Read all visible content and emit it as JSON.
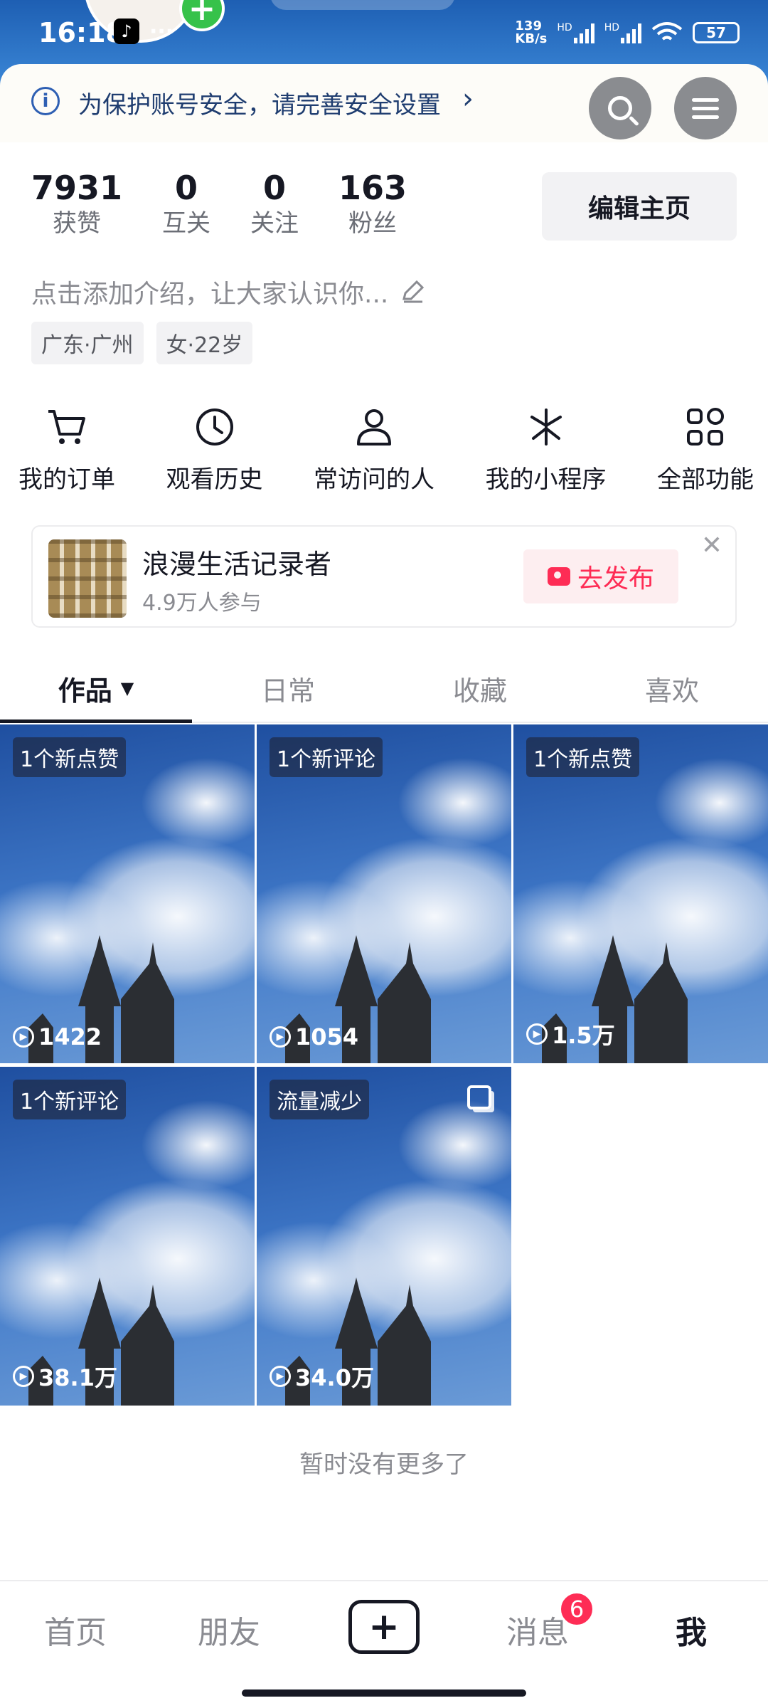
{
  "status_bar": {
    "time": "16:18",
    "net_speed_value": "139",
    "net_speed_unit": "KB/s",
    "hd1": "HD",
    "hd2": "HD",
    "battery": "57"
  },
  "security_banner": {
    "text": "为保护账号安全，请完善安全设置",
    "icon": "info-icon"
  },
  "stats": [
    {
      "value": "7931",
      "label": "获赞"
    },
    {
      "value": "0",
      "label": "互关"
    },
    {
      "value": "0",
      "label": "关注"
    },
    {
      "value": "163",
      "label": "粉丝"
    }
  ],
  "edit_profile_label": "编辑主页",
  "bio_placeholder": "点击添加介绍，让大家认识你...",
  "tags": [
    "广东·广州",
    "女·22岁"
  ],
  "features": [
    {
      "label": "我的订单",
      "icon": "cart-icon"
    },
    {
      "label": "观看历史",
      "icon": "clock-icon"
    },
    {
      "label": "常访问的人",
      "icon": "person-icon"
    },
    {
      "label": "我的小程序",
      "icon": "asterisk-icon"
    },
    {
      "label": "全部功能",
      "icon": "grid-icon"
    }
  ],
  "campaign": {
    "title": "浪漫生活记录者",
    "participants": "4.9万人参与",
    "button_label": "去发布"
  },
  "tabs": [
    {
      "label": "作品",
      "active": true
    },
    {
      "label": "日常",
      "active": false
    },
    {
      "label": "收藏",
      "active": false
    },
    {
      "label": "喜欢",
      "active": false
    }
  ],
  "videos": [
    {
      "badge": "1个新点赞",
      "plays": "1422"
    },
    {
      "badge": "1个新评论",
      "plays": "1054"
    },
    {
      "badge": "1个新点赞",
      "plays": "1.5万"
    },
    {
      "badge": "1个新评论",
      "plays": "38.1万"
    },
    {
      "badge": "流量减少",
      "plays": "34.0万",
      "multi": true
    }
  ],
  "end_text": "暂时没有更多了",
  "bottom_nav": {
    "items": [
      "首页",
      "朋友",
      "消息",
      "我"
    ],
    "active": "我",
    "messages_badge": "6"
  },
  "colors": {
    "accent": "#fe2c55",
    "text_primary": "#161823",
    "text_secondary": "#8a8b91"
  }
}
